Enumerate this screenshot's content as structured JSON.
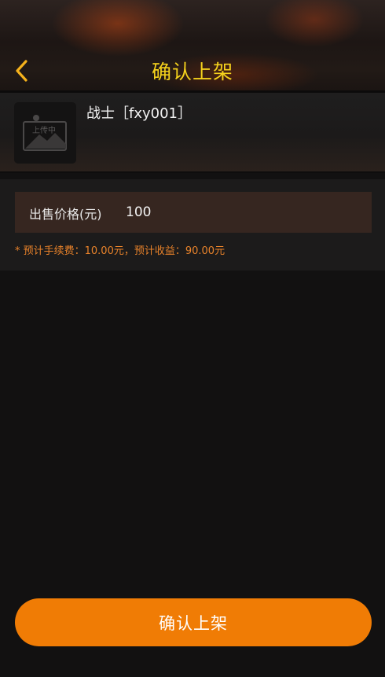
{
  "header": {
    "title": "确认上架",
    "back_icon": "chevron-left-icon",
    "accent_color": "#f5d21c"
  },
  "item": {
    "name": "战士［fxy001］",
    "thumbnail_icon": "image-placeholder-icon",
    "thumbnail_text": "上传中"
  },
  "price": {
    "label": "出售价格(元)",
    "value": "100"
  },
  "fee_note": "* 预计手续费：10.00元，预计收益：90.00元",
  "confirm_button": {
    "label": "确认上架",
    "color": "#f07c05"
  }
}
